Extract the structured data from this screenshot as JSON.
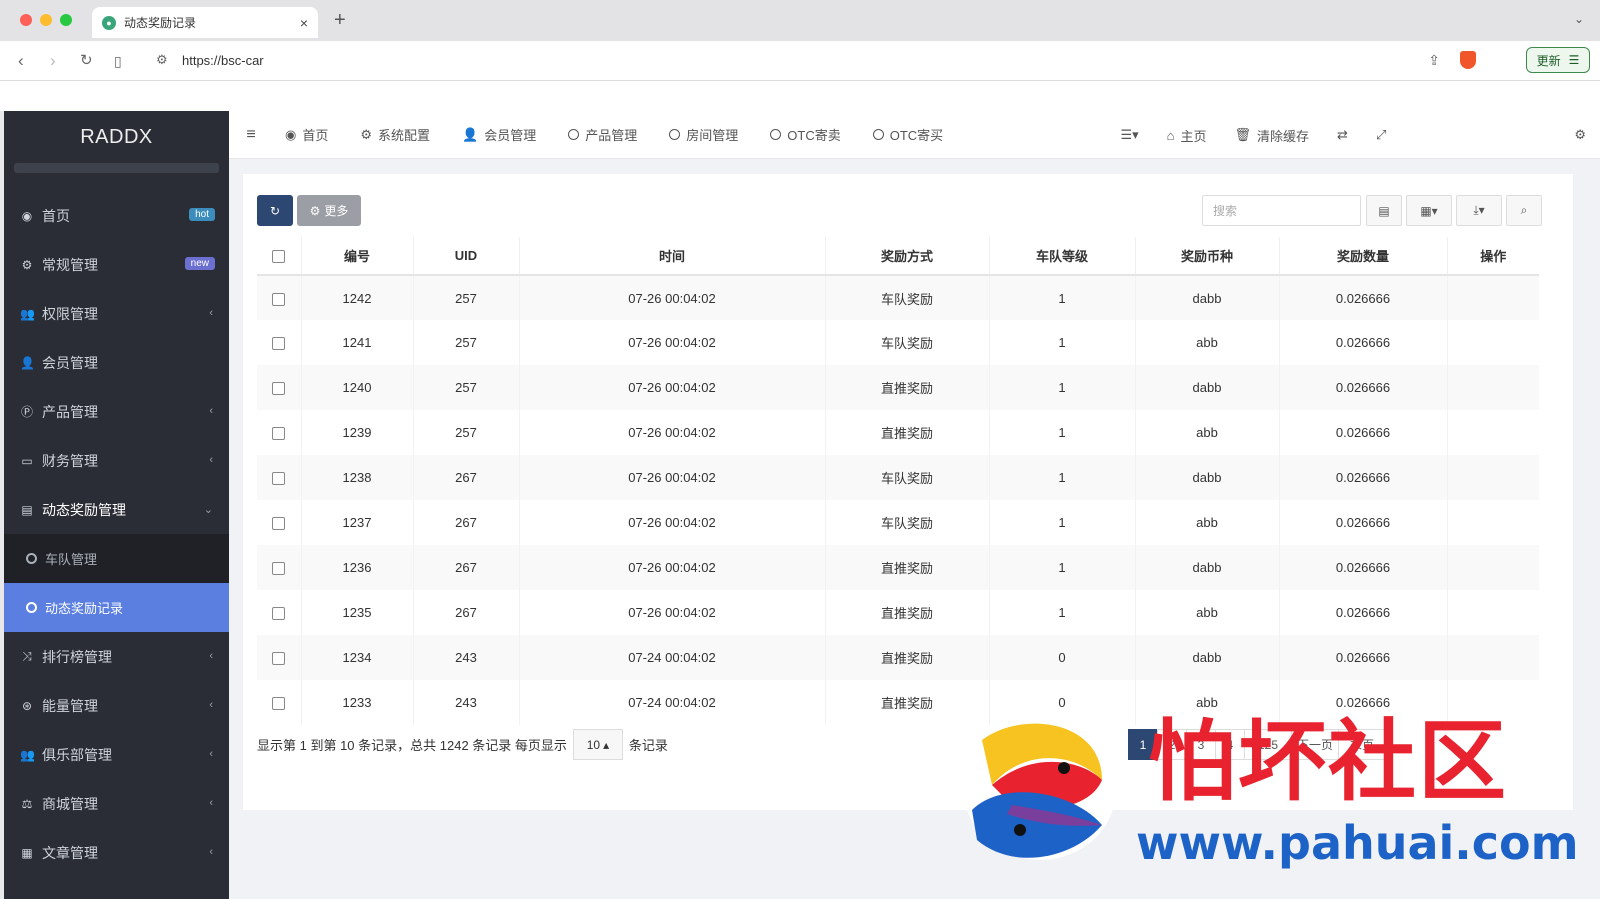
{
  "browser": {
    "tab_title": "动态奖励记录",
    "tab_close": "×",
    "new_tab": "+",
    "url": "https://bsc-car",
    "update_label": "更新"
  },
  "sidebar": {
    "logo": "RADDX",
    "items": [
      {
        "label": "首页",
        "icon": "dashboard-icon",
        "badge": "hot"
      },
      {
        "label": "常规管理",
        "icon": "cogs-icon",
        "badge": "new"
      },
      {
        "label": "权限管理",
        "icon": "group-icon"
      },
      {
        "label": "会员管理",
        "icon": "user-icon"
      },
      {
        "label": "产品管理",
        "icon": "product-icon"
      },
      {
        "label": "财务管理",
        "icon": "credit-card-icon"
      },
      {
        "label": "动态奖励管理",
        "icon": "trash-icon"
      }
    ],
    "subitems": [
      {
        "label": "车队管理"
      },
      {
        "label": "动态奖励记录"
      }
    ],
    "items_after": [
      {
        "label": "排行榜管理",
        "icon": "random-icon"
      },
      {
        "label": "能量管理",
        "icon": "energy-icon"
      },
      {
        "label": "俱乐部管理",
        "icon": "group-icon"
      },
      {
        "label": "商城管理",
        "icon": "balance-icon"
      },
      {
        "label": "文章管理",
        "icon": "newspaper-icon"
      }
    ]
  },
  "topnav": {
    "items": [
      "首页",
      "系统配置",
      "会员管理",
      "产品管理",
      "房间管理",
      "OTC寄卖",
      "OTC寄买"
    ],
    "right": {
      "home": "主页",
      "clear_cache": "清除缓存"
    }
  },
  "toolbar": {
    "more_label": "更多",
    "search_placeholder": "搜索"
  },
  "table": {
    "columns": [
      "编号",
      "UID",
      "时间",
      "奖励方式",
      "车队等级",
      "奖励币种",
      "奖励数量",
      "操作"
    ],
    "rows": [
      {
        "id": "1242",
        "uid": "257",
        "time": "07-26 00:04:02",
        "method": "车队奖励",
        "level": "1",
        "coin": "dabb",
        "amount": "0.026666"
      },
      {
        "id": "1241",
        "uid": "257",
        "time": "07-26 00:04:02",
        "method": "车队奖励",
        "level": "1",
        "coin": "abb",
        "amount": "0.026666"
      },
      {
        "id": "1240",
        "uid": "257",
        "time": "07-26 00:04:02",
        "method": "直推奖励",
        "level": "1",
        "coin": "dabb",
        "amount": "0.026666"
      },
      {
        "id": "1239",
        "uid": "257",
        "time": "07-26 00:04:02",
        "method": "直推奖励",
        "level": "1",
        "coin": "abb",
        "amount": "0.026666"
      },
      {
        "id": "1238",
        "uid": "267",
        "time": "07-26 00:04:02",
        "method": "车队奖励",
        "level": "1",
        "coin": "dabb",
        "amount": "0.026666"
      },
      {
        "id": "1237",
        "uid": "267",
        "time": "07-26 00:04:02",
        "method": "车队奖励",
        "level": "1",
        "coin": "abb",
        "amount": "0.026666"
      },
      {
        "id": "1236",
        "uid": "267",
        "time": "07-26 00:04:02",
        "method": "直推奖励",
        "level": "1",
        "coin": "dabb",
        "amount": "0.026666"
      },
      {
        "id": "1235",
        "uid": "267",
        "time": "07-26 00:04:02",
        "method": "直推奖励",
        "level": "1",
        "coin": "abb",
        "amount": "0.026666"
      },
      {
        "id": "1234",
        "uid": "243",
        "time": "07-24 00:04:02",
        "method": "直推奖励",
        "level": "0",
        "coin": "dabb",
        "amount": "0.026666"
      },
      {
        "id": "1233",
        "uid": "243",
        "time": "07-24 00:04:02",
        "method": "直推奖励",
        "level": "0",
        "coin": "abb",
        "amount": "0.026666"
      }
    ]
  },
  "pager": {
    "info_prefix": "显示第 1 到第 10 条记录，总共 1242 条记录 每页显示",
    "page_size": "10",
    "info_suffix": "条记录",
    "pages": [
      "1",
      "2",
      "3",
      "4",
      "125",
      "下一页",
      "末页"
    ]
  },
  "watermark": {
    "title": "怕坏社区",
    "url": "www.pahuai.com"
  },
  "colors": {
    "sidebar_bg": "#2a2d35",
    "active_menu": "#5a7fe0",
    "primary_button": "#2d4773",
    "green_text": "#5aae7b",
    "red_text": "#d6695a"
  }
}
